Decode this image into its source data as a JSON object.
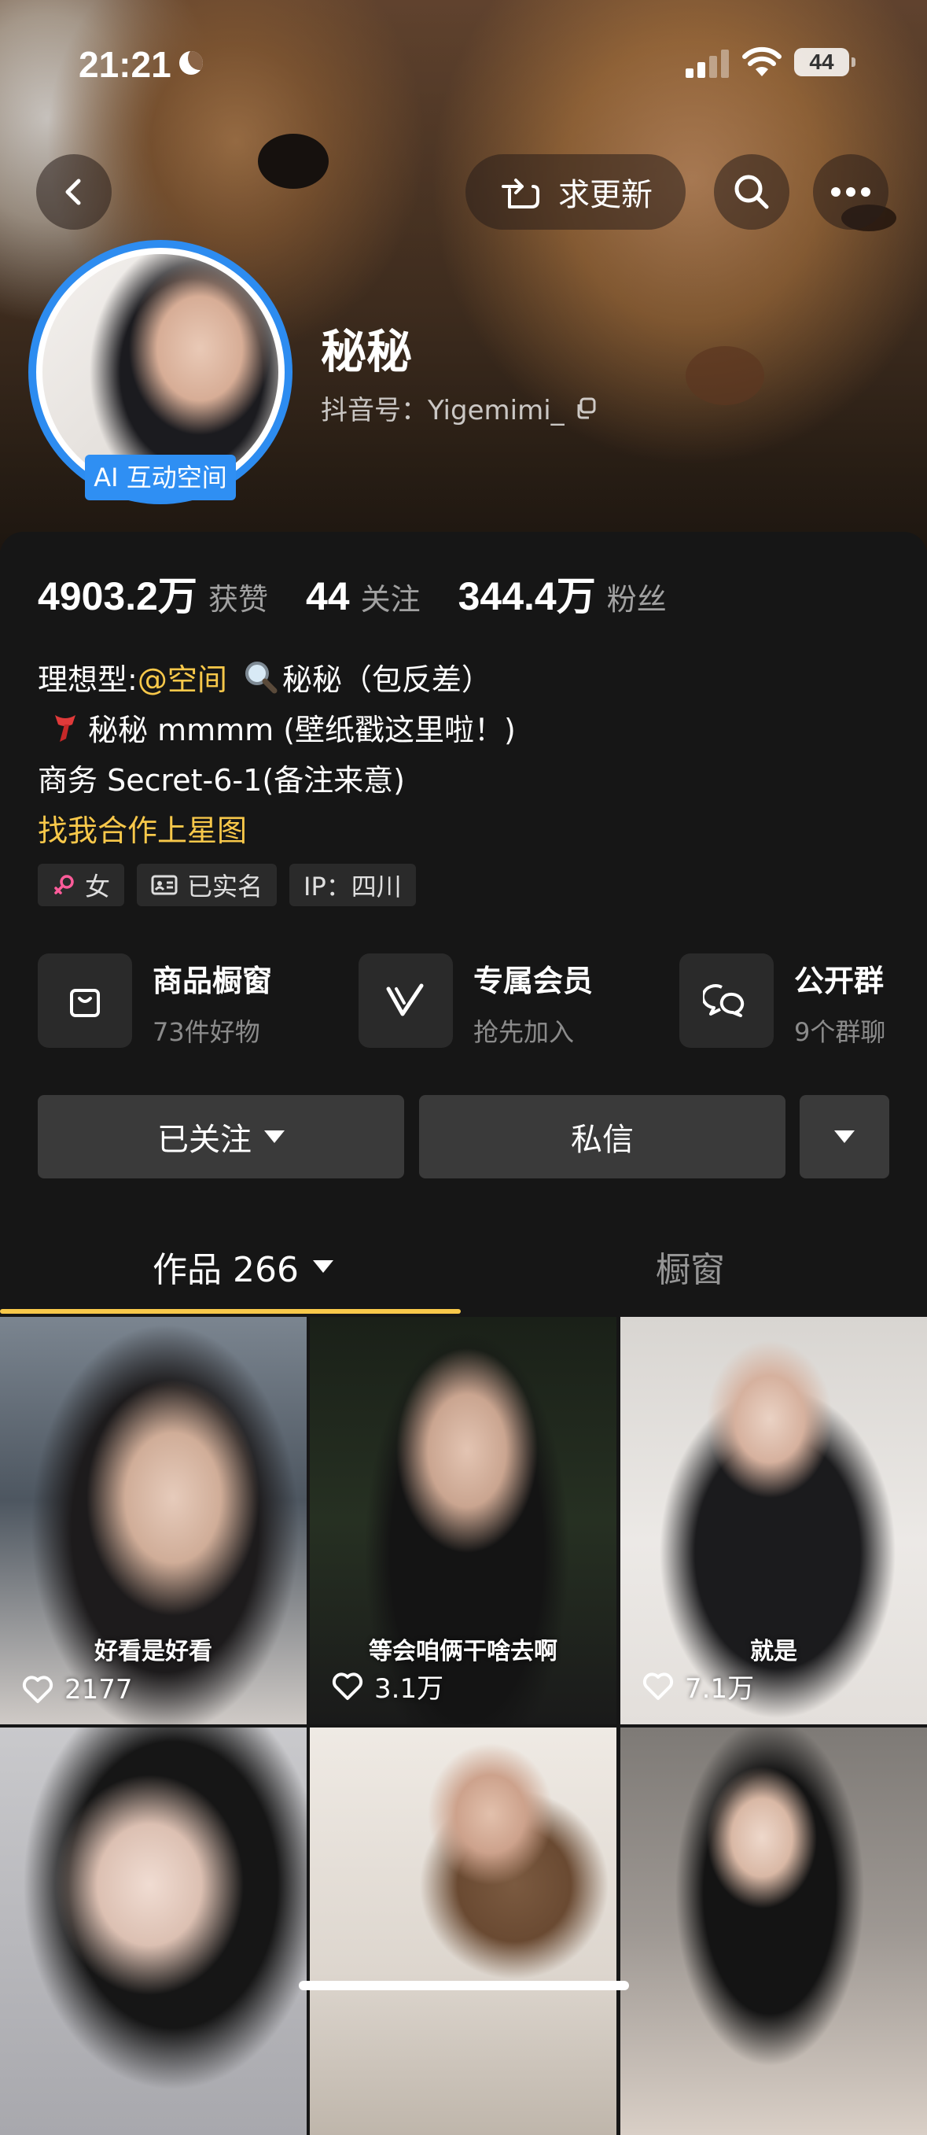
{
  "status_bar": {
    "time": "21:21",
    "battery": "44"
  },
  "header": {
    "update_button_label": "求更新"
  },
  "profile": {
    "name": "秘秘",
    "douyin_id": "抖音号：Yigemimi_",
    "ai_badge": "AI 互动空间"
  },
  "stats": [
    {
      "value": "4903.2万",
      "label": "获赞"
    },
    {
      "value": "44",
      "label": "关注"
    },
    {
      "value": "344.4万",
      "label": "粉丝"
    }
  ],
  "bio": {
    "line1_prefix": "理想型:",
    "line1_mention": "@空间",
    "line1_suffix": "秘秘（包反差）",
    "line2": "秘秘 mmmm (壁纸戳这里啦！)",
    "line3": "商务 Secret-6-1(备注来意)",
    "link": "找我合作上星图"
  },
  "tags": [
    {
      "icon": "female-icon",
      "label": "女"
    },
    {
      "icon": "id-card-icon",
      "label": "已实名"
    },
    {
      "icon": "",
      "label": "IP：四川"
    }
  ],
  "features": [
    {
      "icon": "shopping-bag-icon",
      "title": "商品橱窗",
      "subtitle": "73件好物"
    },
    {
      "icon": "v-member-icon",
      "title": "专属会员",
      "subtitle": "抢先加入"
    },
    {
      "icon": "chat-bubbles-icon",
      "title": "公开群",
      "subtitle": "9个群聊"
    }
  ],
  "actions": {
    "follow_label": "已关注",
    "message_label": "私信"
  },
  "tabs": {
    "works_label": "作品 266",
    "showcase_label": "橱窗"
  },
  "videos": [
    {
      "caption": "好看是好看",
      "likes": "2177"
    },
    {
      "caption": "等会咱俩干啥去啊",
      "likes": "3.1万"
    },
    {
      "caption": "就是",
      "likes": "7.1万"
    },
    {
      "caption": "",
      "likes": ""
    },
    {
      "caption": "",
      "likes": ""
    },
    {
      "caption": "",
      "likes": ""
    }
  ],
  "colors": {
    "accent": "#f8c84a",
    "ai_badge": "#2f8ff3",
    "background": "#161616"
  }
}
